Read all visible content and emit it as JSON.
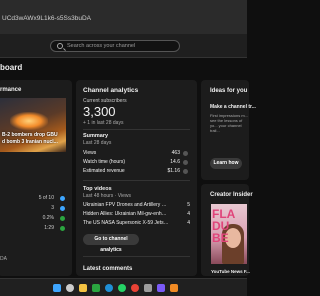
{
  "browser": {
    "url": "UCd3wAWx9L1k6-s5Ss3buDA"
  },
  "header": {
    "search_placeholder": "Search across your channel"
  },
  "page": {
    "title": "board"
  },
  "performance": {
    "title": "rmance",
    "thumbnail_caption": "B-2 bombers drop GBU\nd bomb 3 Iranian nucl...",
    "stats": [
      {
        "value": "5 of 10",
        "color": "#3ea6ff"
      },
      {
        "value": "3",
        "color": "#3ea6ff"
      },
      {
        "value": "0.2%",
        "color": "#2ba640"
      },
      {
        "value": "1:29",
        "color": "#2ba640"
      }
    ],
    "bottom_text": "DA"
  },
  "analytics": {
    "title": "Channel analytics",
    "subscribers_label": "Current subscribers",
    "subscribers_value": "3,300",
    "subscribers_change": "+ 1 in last 28 days",
    "summary_title": "Summary",
    "summary_period": "Last 28 days",
    "metrics": [
      {
        "label": "Views",
        "value": "463"
      },
      {
        "label": "Watch time (hours)",
        "value": "14.6"
      },
      {
        "label": "Estimated revenue",
        "value": "$1.16"
      }
    ],
    "top_video_title": "Top videos",
    "top_video_period": "Last 48 hours · Views",
    "top_videos": [
      {
        "title": "Ukrainian FPV Drones and Artillery Destroying Russian ...",
        "count": "5"
      },
      {
        "title": "Hidden Allies: Ukrainian Mil-gw-enhanced Russi...",
        "count": "4"
      },
      {
        "title": "The US NASA Supersonic X-59 Jets Takeoff : Quiet and ...",
        "count": "4"
      }
    ],
    "button_label": "Go to channel analytics",
    "latest_comments": "Latest comments"
  },
  "ideas": {
    "title": "Ideas for you",
    "subtitle": "Make a channel tr...",
    "text": "First impressions m... see the lessons of yo... your channel trail...",
    "button_label": "Learn how"
  },
  "insider": {
    "title": "Creator Insider",
    "image_text": "FLA\nDU\nBE",
    "caption": "YouTube News F..."
  },
  "taskbar": {
    "left_text": "",
    "icons": [
      {
        "name": "start-icon",
        "color": "#3ea6ff"
      },
      {
        "name": "search-taskbar-icon",
        "color": "#cccccc"
      },
      {
        "name": "file-explorer-icon",
        "color": "#f5c342"
      },
      {
        "name": "browser-icon",
        "color": "#2ba640"
      },
      {
        "name": "edge-icon",
        "color": "#1f8fd6"
      },
      {
        "name": "whatsapp-icon",
        "color": "#25d366"
      },
      {
        "name": "chrome-icon",
        "color": "#e94235"
      },
      {
        "name": "settings-icon",
        "color": "#9c9c9c"
      },
      {
        "name": "app-icon",
        "color": "#7a5af8"
      },
      {
        "name": "photos-icon",
        "color": "#f08a24"
      }
    ]
  }
}
